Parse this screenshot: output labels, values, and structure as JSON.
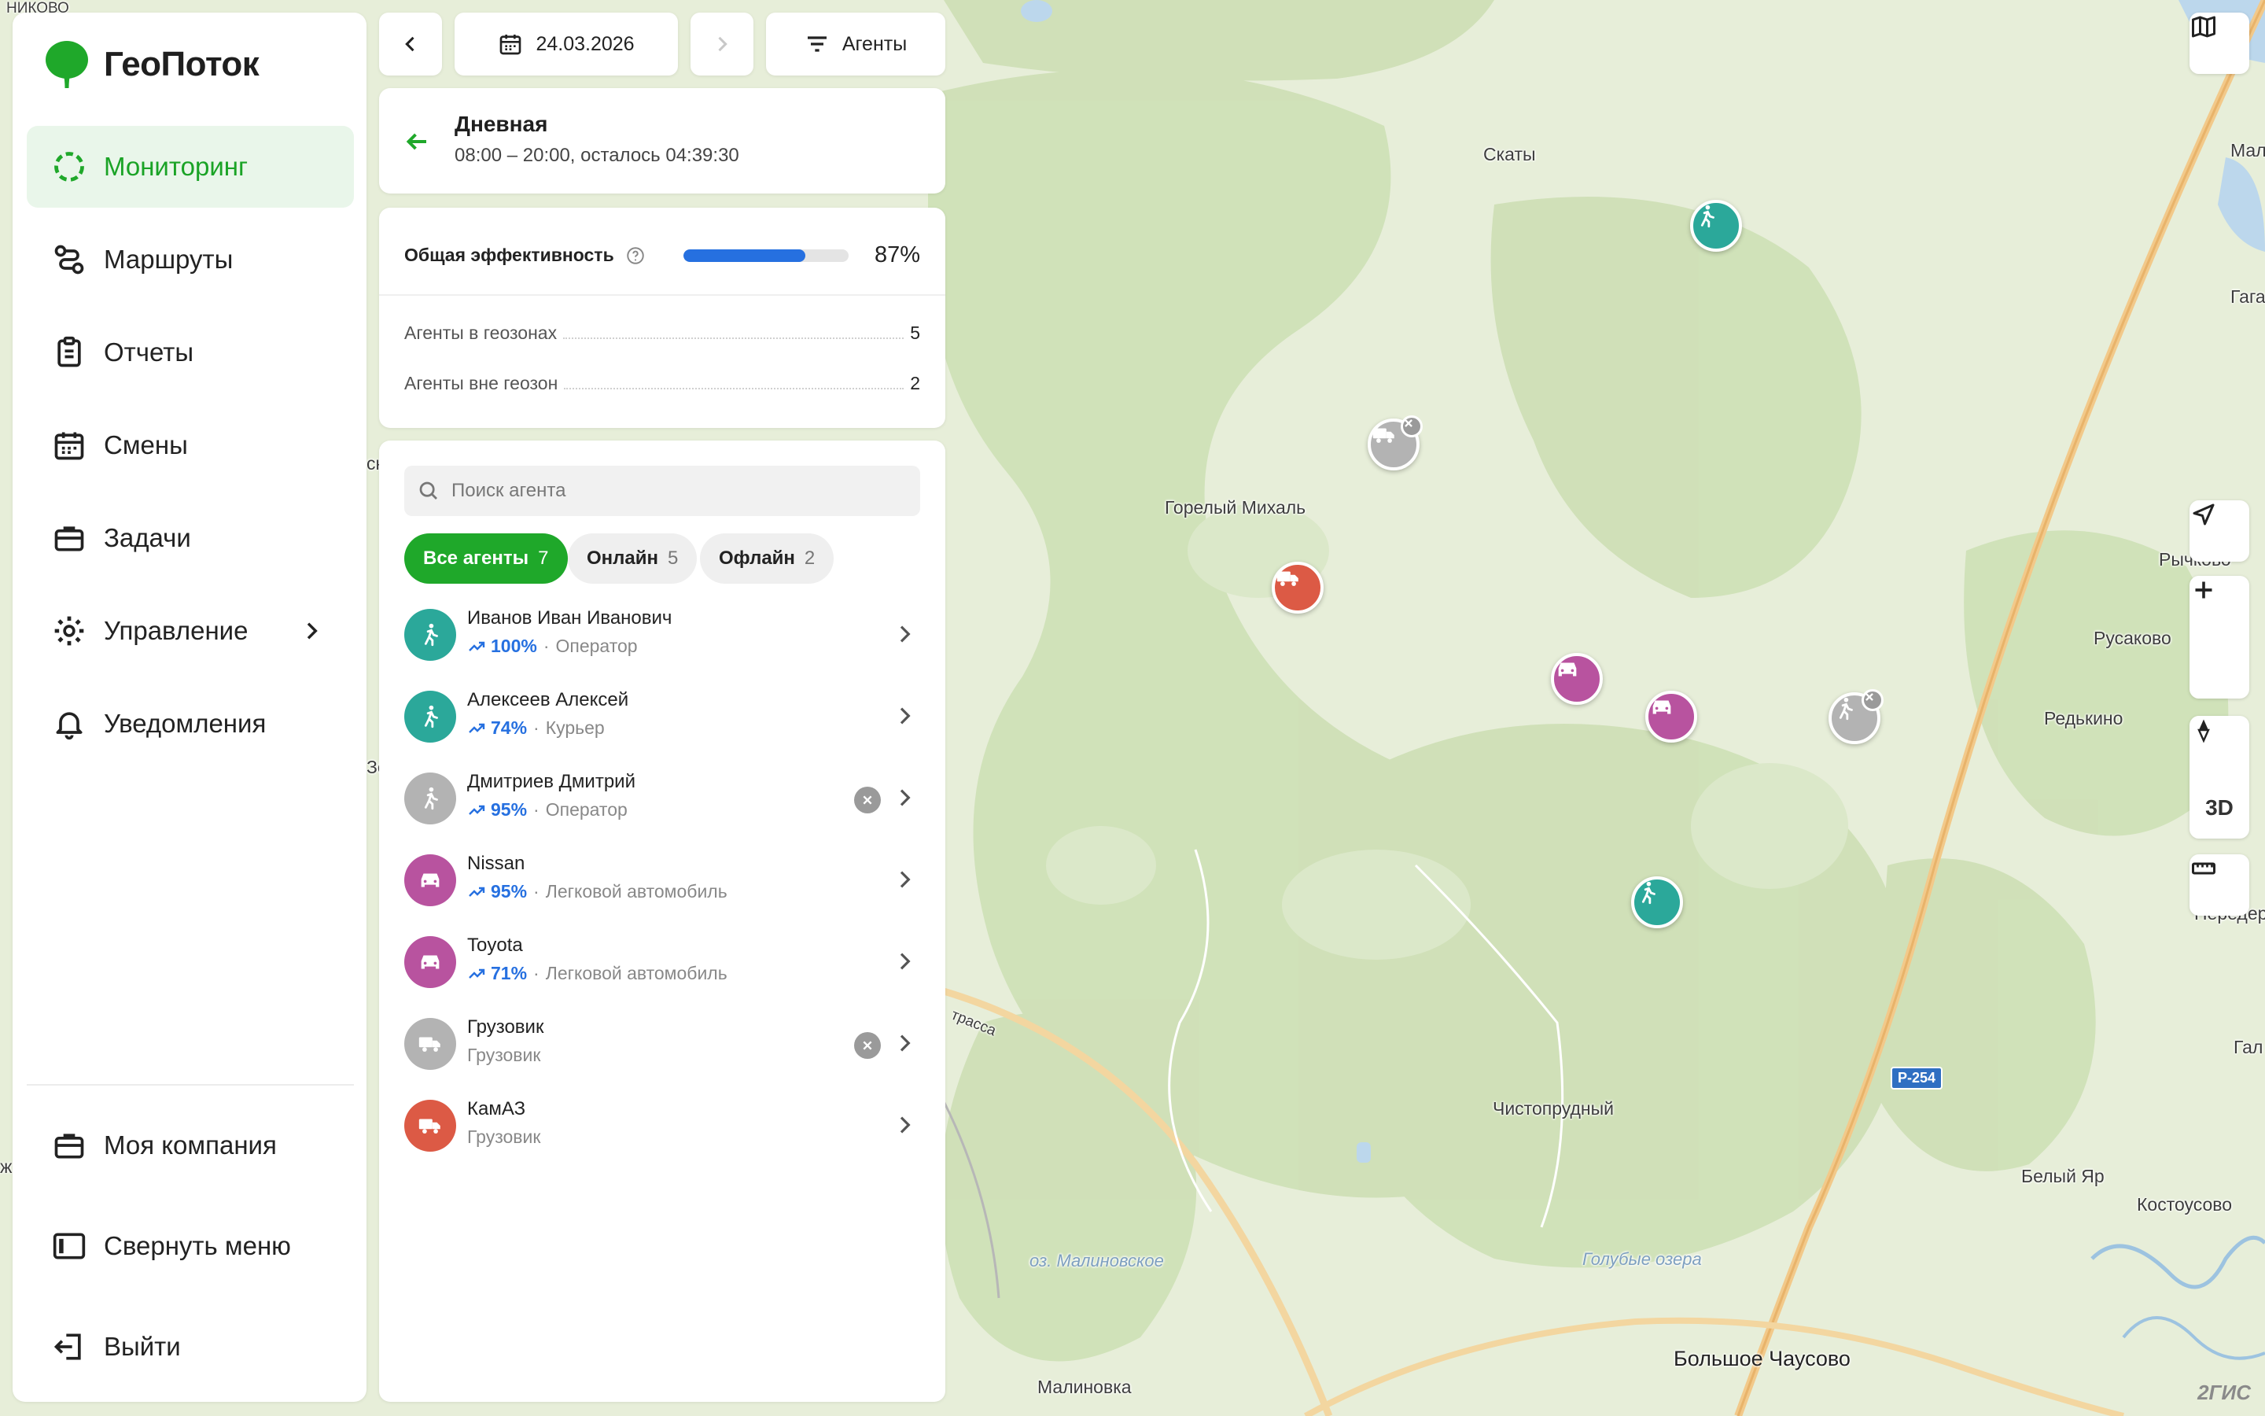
{
  "app": {
    "name": "ГеоПоток"
  },
  "nav": {
    "items": [
      {
        "label": "Мониторинг",
        "icon": "monitoring-icon",
        "active": true
      },
      {
        "label": "Маршруты",
        "icon": "routes-icon"
      },
      {
        "label": "Отчеты",
        "icon": "clipboard-icon"
      },
      {
        "label": "Смены",
        "icon": "calendar-icon"
      },
      {
        "label": "Задачи",
        "icon": "briefcase-icon"
      },
      {
        "label": "Управление",
        "icon": "gear-icon"
      },
      {
        "label": "Уведомления",
        "icon": "bell-icon"
      }
    ],
    "bottom": [
      {
        "label": "Моя компания",
        "icon": "briefcase-icon"
      },
      {
        "label": "Свернуть меню",
        "icon": "sidebar-collapse-icon"
      },
      {
        "label": "Выйти",
        "icon": "logout-icon"
      }
    ]
  },
  "toolbar": {
    "date": "24.03.2026",
    "filter_label": "Агенты"
  },
  "shift": {
    "title": "Дневная",
    "subtitle": "08:00 – 20:00, осталось 04:39:30"
  },
  "stats": {
    "efficiency_label": "Общая эффективность",
    "efficiency_value": "87%",
    "efficiency_fraction": 0.74,
    "in_geo_label": "Агенты в геозонах",
    "in_geo_value": "5",
    "out_geo_label": "Агенты вне геозон",
    "out_geo_value": "2"
  },
  "search": {
    "placeholder": "Поиск агента"
  },
  "filters": [
    {
      "label": "Все агенты",
      "count": "7",
      "active": true
    },
    {
      "label": "Онлайн",
      "count": "5"
    },
    {
      "label": "Офлайн",
      "count": "2"
    }
  ],
  "agents": [
    {
      "name": "Иванов Иван Иванович",
      "pct": "100%",
      "role": "Оператор",
      "type": "walker",
      "color": "#2ba89a",
      "offline": false
    },
    {
      "name": "Алексеев Алексей",
      "pct": "74%",
      "role": "Курьер",
      "type": "walker",
      "color": "#2ba89a",
      "offline": false
    },
    {
      "name": "Дмитриев Дмитрий",
      "pct": "95%",
      "role": "Оператор",
      "type": "walker",
      "color": "#b3b3b3",
      "offline": true
    },
    {
      "name": "Nissan",
      "pct": "95%",
      "role": "Легковой автомобиль",
      "type": "car",
      "color": "#b8539f",
      "offline": false
    },
    {
      "name": "Toyota",
      "pct": "71%",
      "role": "Легковой автомобиль",
      "type": "car",
      "color": "#b8539f",
      "offline": false
    },
    {
      "name": "Грузовик",
      "pct": "",
      "role": "Грузовик",
      "type": "truck",
      "color": "#b3b3b3",
      "offline": true
    },
    {
      "name": "КамАЗ",
      "pct": "",
      "role": "Грузовик",
      "type": "truck",
      "color": "#dc5a45",
      "offline": false
    }
  ],
  "map": {
    "places": [
      "Скаты",
      "Горелый Михаль",
      "Рычково",
      "Русаково",
      "Редькино",
      "Чистопрудный",
      "Белый Яр",
      "Костоусово",
      "Малиновка",
      "Большое Чаусово",
      "оз. Малиновское",
      "Голубые озера",
      "трасса",
      "НИКОВО",
      "Мал",
      "Гага",
      "Передер",
      "Гал",
      "Зе",
      "сн",
      "ж"
    ],
    "road_badge": "Р-254",
    "watermark": "2ГИС",
    "ctrl_3d": "3D"
  },
  "colors": {
    "accent": "#1fa82a",
    "progress": "#2670e0"
  }
}
